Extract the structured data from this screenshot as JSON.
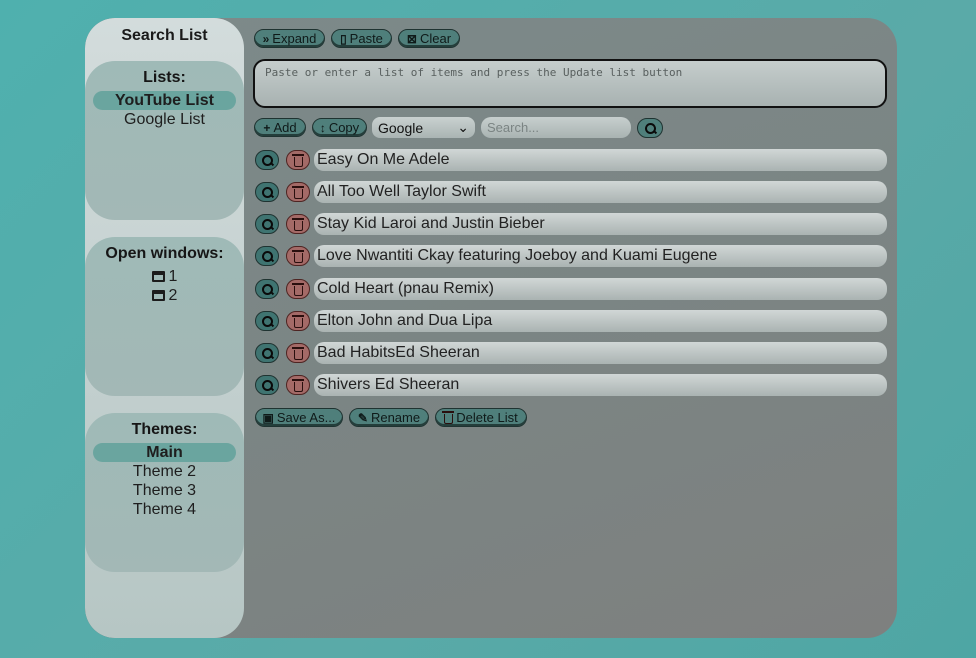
{
  "sidebar": {
    "title": "Search List",
    "lists": {
      "heading": "Lists:",
      "items": [
        "YouTube List",
        "Google List"
      ]
    },
    "windows": {
      "heading": "Open windows:",
      "items": [
        "1",
        "2"
      ]
    },
    "themes": {
      "heading": "Themes:",
      "items": [
        "Main",
        "Theme 2",
        "Theme 3",
        "Theme 4"
      ]
    }
  },
  "toolbar": {
    "expand": "Expand",
    "paste": "Paste",
    "clear": "Clear"
  },
  "textarea": {
    "placeholder": "Paste or enter a list of items and press the Update list button"
  },
  "controls": {
    "add": "Add",
    "copy": "Copy",
    "engine": "Google",
    "search_placeholder": "Search..."
  },
  "items": [
    "Easy On Me Adele",
    "All Too Well Taylor Swift",
    "Stay Kid Laroi and Justin Bieber",
    "Love Nwantiti Ckay featuring Joeboy and Kuami Eugene",
    "Cold Heart (pnau Remix)",
    "Elton John and Dua Lipa",
    "Bad HabitsEd Sheeran",
    "Shivers Ed Sheeran"
  ],
  "bottom": {
    "save_as": "Save As...",
    "rename": "Rename",
    "delete_list": "Delete List"
  },
  "colors": {
    "accent": "#4f7f7b",
    "delete": "#a46a67",
    "background": "#4fb0ae"
  }
}
